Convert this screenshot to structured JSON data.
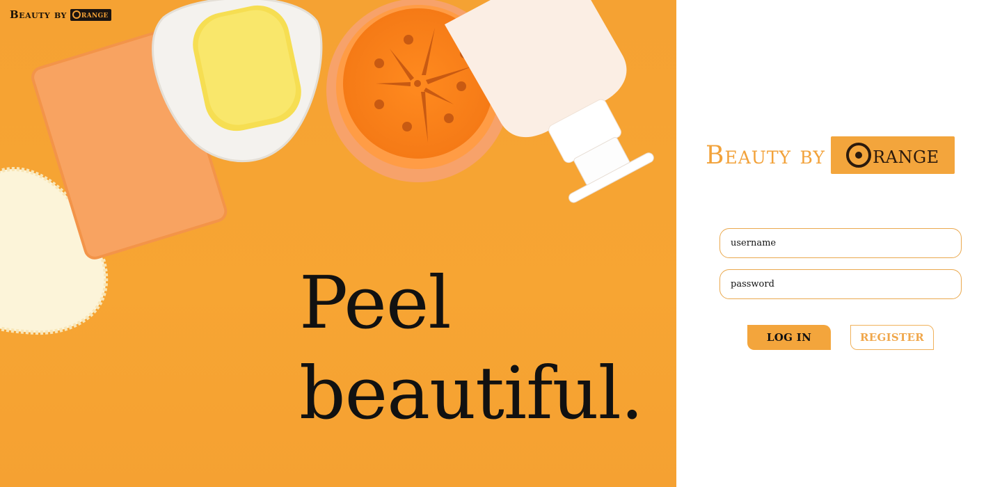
{
  "brand": {
    "name_prefix": "Beauty by",
    "name_suffix": "range",
    "colors": {
      "accent": "#f3a53c",
      "dark": "#2b1a0d",
      "hero_bg": "#f7a533"
    }
  },
  "hero": {
    "tagline_line1": "Peel",
    "tagline_line2": "beautiful."
  },
  "login": {
    "username_placeholder": "username",
    "password_placeholder": "password",
    "login_label": "LOG IN",
    "register_label": "REGISTER"
  }
}
